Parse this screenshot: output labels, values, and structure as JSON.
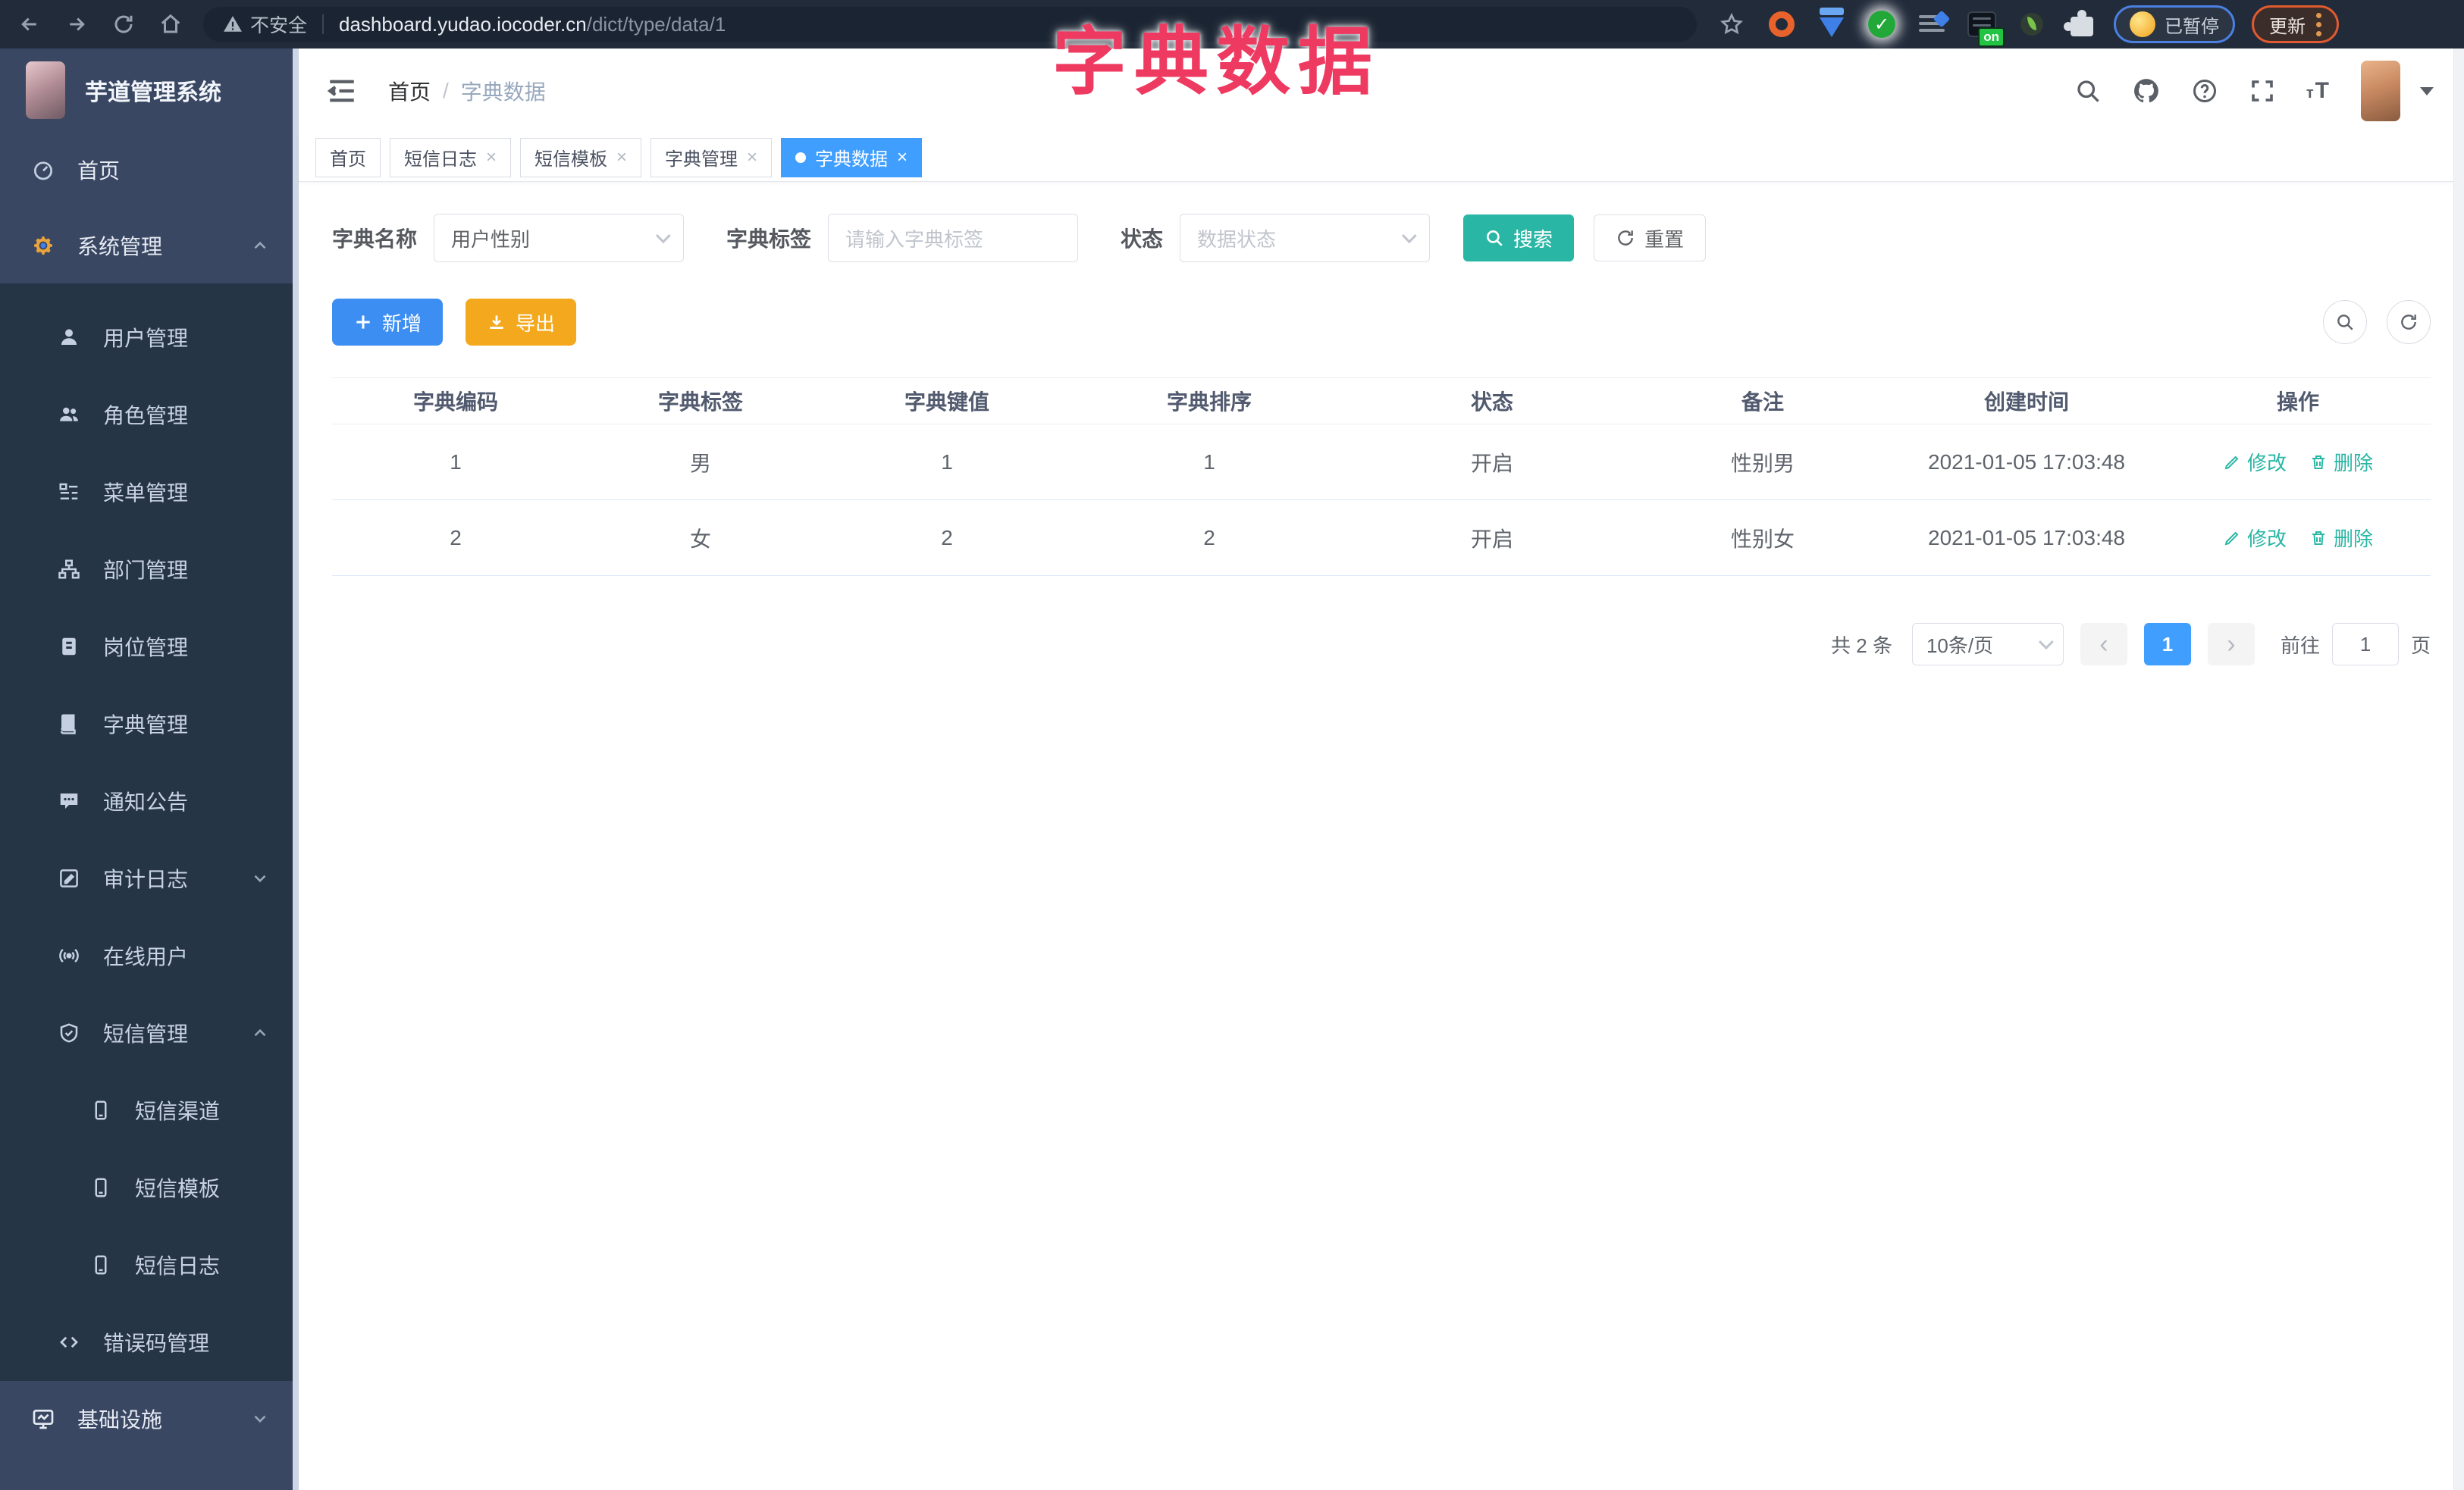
{
  "browser": {
    "security": "不安全",
    "host": "dashboard.yudao.iocoder.cn",
    "path": "/dict/type/data/1",
    "on_badge": "on",
    "paused_badge": "已暂停",
    "update_label": "更新"
  },
  "overlay": {
    "title": "字典数据"
  },
  "sidebar": {
    "logo_title": "芋道管理系统",
    "items": [
      {
        "label": "首页"
      },
      {
        "label": "系统管理"
      },
      {
        "label": "用户管理"
      },
      {
        "label": "角色管理"
      },
      {
        "label": "菜单管理"
      },
      {
        "label": "部门管理"
      },
      {
        "label": "岗位管理"
      },
      {
        "label": "字典管理"
      },
      {
        "label": "通知公告"
      },
      {
        "label": "审计日志"
      },
      {
        "label": "在线用户"
      },
      {
        "label": "短信管理"
      },
      {
        "label": "短信渠道"
      },
      {
        "label": "短信模板"
      },
      {
        "label": "短信日志"
      },
      {
        "label": "错误码管理"
      },
      {
        "label": "基础设施"
      }
    ]
  },
  "header": {
    "breadcrumb_home": "首页",
    "breadcrumb_sep": "/",
    "breadcrumb_current": "字典数据"
  },
  "tabs": [
    {
      "label": "首页"
    },
    {
      "label": "短信日志"
    },
    {
      "label": "短信模板"
    },
    {
      "label": "字典管理"
    },
    {
      "label": "字典数据"
    }
  ],
  "filters": {
    "name_label": "字典名称",
    "name_value": "用户性别",
    "tag_label": "字典标签",
    "tag_placeholder": "请输入字典标签",
    "status_label": "状态",
    "status_placeholder": "数据状态",
    "search_label": "搜索",
    "reset_label": "重置"
  },
  "toolbar": {
    "add_label": "新增",
    "export_label": "导出"
  },
  "table": {
    "columns": [
      "字典编码",
      "字典标签",
      "字典键值",
      "字典排序",
      "状态",
      "备注",
      "创建时间",
      "操作"
    ],
    "edit_label": "修改",
    "delete_label": "删除",
    "rows": [
      {
        "code": "1",
        "label": "男",
        "value": "1",
        "sort": "1",
        "status": "开启",
        "remark": "性别男",
        "created": "2021-01-05 17:03:48"
      },
      {
        "code": "2",
        "label": "女",
        "value": "2",
        "sort": "2",
        "status": "开启",
        "remark": "性别女",
        "created": "2021-01-05 17:03:48"
      }
    ]
  },
  "pagination": {
    "total": "共 2 条",
    "page_size": "10条/页",
    "current_page": "1",
    "goto_label": "前往",
    "goto_value": "1",
    "page_unit": "页"
  },
  "colors": {
    "accent_blue": "#409eff",
    "teal": "#2ab6a4",
    "export_orange": "#f3a81d",
    "overlay_pink": "#ee3a61",
    "sidebar_dark": "#253546",
    "sidebar_light": "#394763"
  }
}
